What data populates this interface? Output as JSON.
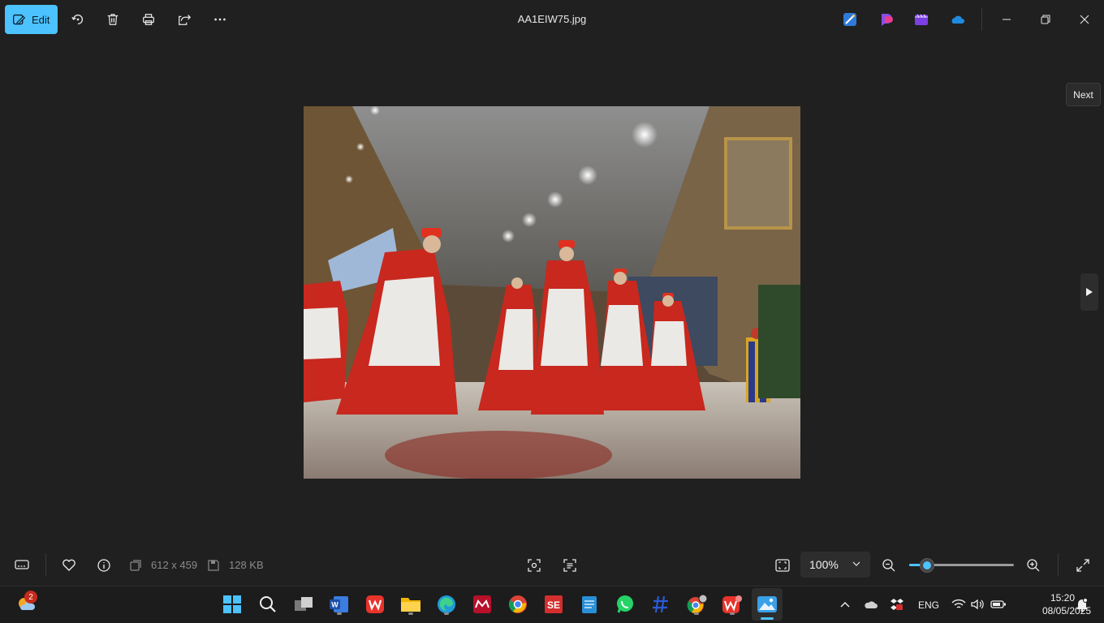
{
  "toolbar": {
    "edit_label": "Edit",
    "file_title": "AA1EIW75.jpg",
    "icons": [
      "rotate-icon",
      "delete-icon",
      "print-icon",
      "share-icon",
      "more-icon"
    ],
    "shortcuts": [
      "designer-icon",
      "clipchamp-icon",
      "video-editor-icon",
      "onedrive-icon"
    ]
  },
  "viewer": {
    "next_tooltip": "Next"
  },
  "bottombar": {
    "dimensions": "612 x 459",
    "file_size": "128 KB",
    "zoom": "100%",
    "zoom_fraction": 0.17
  },
  "taskbar": {
    "weather_badge": "2",
    "apps": [
      "start",
      "search",
      "task-view",
      "word",
      "wps",
      "file-explorer",
      "edge",
      "mendeley",
      "chrome",
      "scientific-editor",
      "notepad",
      "whatsapp",
      "notes-app",
      "chrome-profile",
      "wps-office",
      "photos"
    ],
    "language": "ENG",
    "time": "15:20",
    "date": "08/05/2025"
  },
  "colors": {
    "accent": "#4cc2ff",
    "background": "#202020",
    "taskbar": "#1c1c1c"
  }
}
